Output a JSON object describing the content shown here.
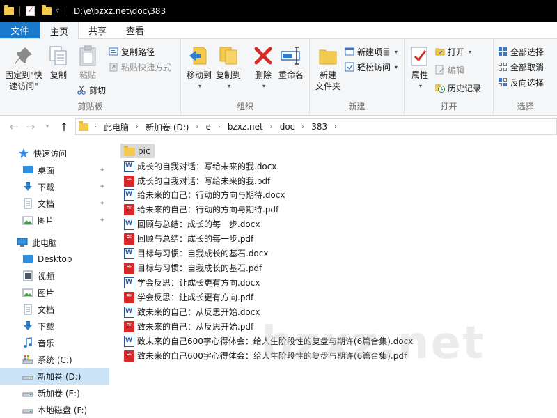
{
  "titlebar": {
    "path": "D:\\e\\bzxz.net\\doc\\383"
  },
  "tabs": [
    {
      "label": "文件"
    },
    {
      "label": "主页"
    },
    {
      "label": "共享"
    },
    {
      "label": "查看"
    }
  ],
  "ribbon": {
    "clipboard": {
      "label": "剪贴板",
      "pin_quick": "固定到\"快\n速访问\"",
      "copy": "复制",
      "paste": "粘贴",
      "copy_path": "复制路径",
      "paste_shortcut": "粘贴快捷方式",
      "cut": "剪切"
    },
    "organize": {
      "label": "组织",
      "move_to": "移动到",
      "copy_to": "复制到",
      "delete": "删除",
      "rename": "重命名"
    },
    "new": {
      "label": "新建",
      "new_folder": "新建\n文件夹",
      "new_item": "新建项目",
      "easy_access": "轻松访问"
    },
    "open": {
      "label": "打开",
      "properties": "属性",
      "open": "打开",
      "edit": "编辑",
      "history": "历史记录"
    },
    "select": {
      "label": "选择",
      "select_all": "全部选择",
      "select_none": "全部取消",
      "invert": "反向选择"
    }
  },
  "address": {
    "crumbs": [
      "此电脑",
      "新加卷 (D:)",
      "e",
      "bzxz.net",
      "doc",
      "383"
    ]
  },
  "navpane": {
    "quick_access": "快速访问",
    "quick_items": [
      "桌面",
      "下载",
      "文档",
      "图片"
    ],
    "this_pc": "此电脑",
    "pc_items": [
      "Desktop",
      "视频",
      "图片",
      "文档",
      "下载",
      "音乐",
      "系统 (C:)",
      "新加卷 (D:)",
      "新加卷 (E:)",
      "本地磁盘 (F:)"
    ]
  },
  "files": [
    {
      "name": "pic",
      "type": "folder"
    },
    {
      "name": "成长的自我对话：写给未来的我.docx",
      "type": "docx"
    },
    {
      "name": "成长的自我对话：写给未来的我.pdf",
      "type": "pdf"
    },
    {
      "name": "给未来的自己：行动的方向与期待.docx",
      "type": "docx"
    },
    {
      "name": "给未来的自己：行动的方向与期待.pdf",
      "type": "pdf"
    },
    {
      "name": "回顾与总结：成长的每一步.docx",
      "type": "docx"
    },
    {
      "name": "回顾与总结：成长的每一步.pdf",
      "type": "pdf"
    },
    {
      "name": "目标与习惯：自我成长的基石.docx",
      "type": "docx"
    },
    {
      "name": "目标与习惯：自我成长的基石.pdf",
      "type": "pdf"
    },
    {
      "name": "学会反思：让成长更有方向.docx",
      "type": "docx"
    },
    {
      "name": "学会反思：让成长更有方向.pdf",
      "type": "pdf"
    },
    {
      "name": "致未来的自己：从反思开始.docx",
      "type": "docx"
    },
    {
      "name": "致未来的自己：从反思开始.pdf",
      "type": "pdf"
    },
    {
      "name": "致未来的自己600字心得体会：给人生阶段性的复盘与期许(6篇合集).docx",
      "type": "docx"
    },
    {
      "name": "致未来的自己600字心得体会：给人生阶段性的复盘与期许(6篇合集).pdf",
      "type": "pdf"
    }
  ],
  "watermark": "bzxz.net"
}
